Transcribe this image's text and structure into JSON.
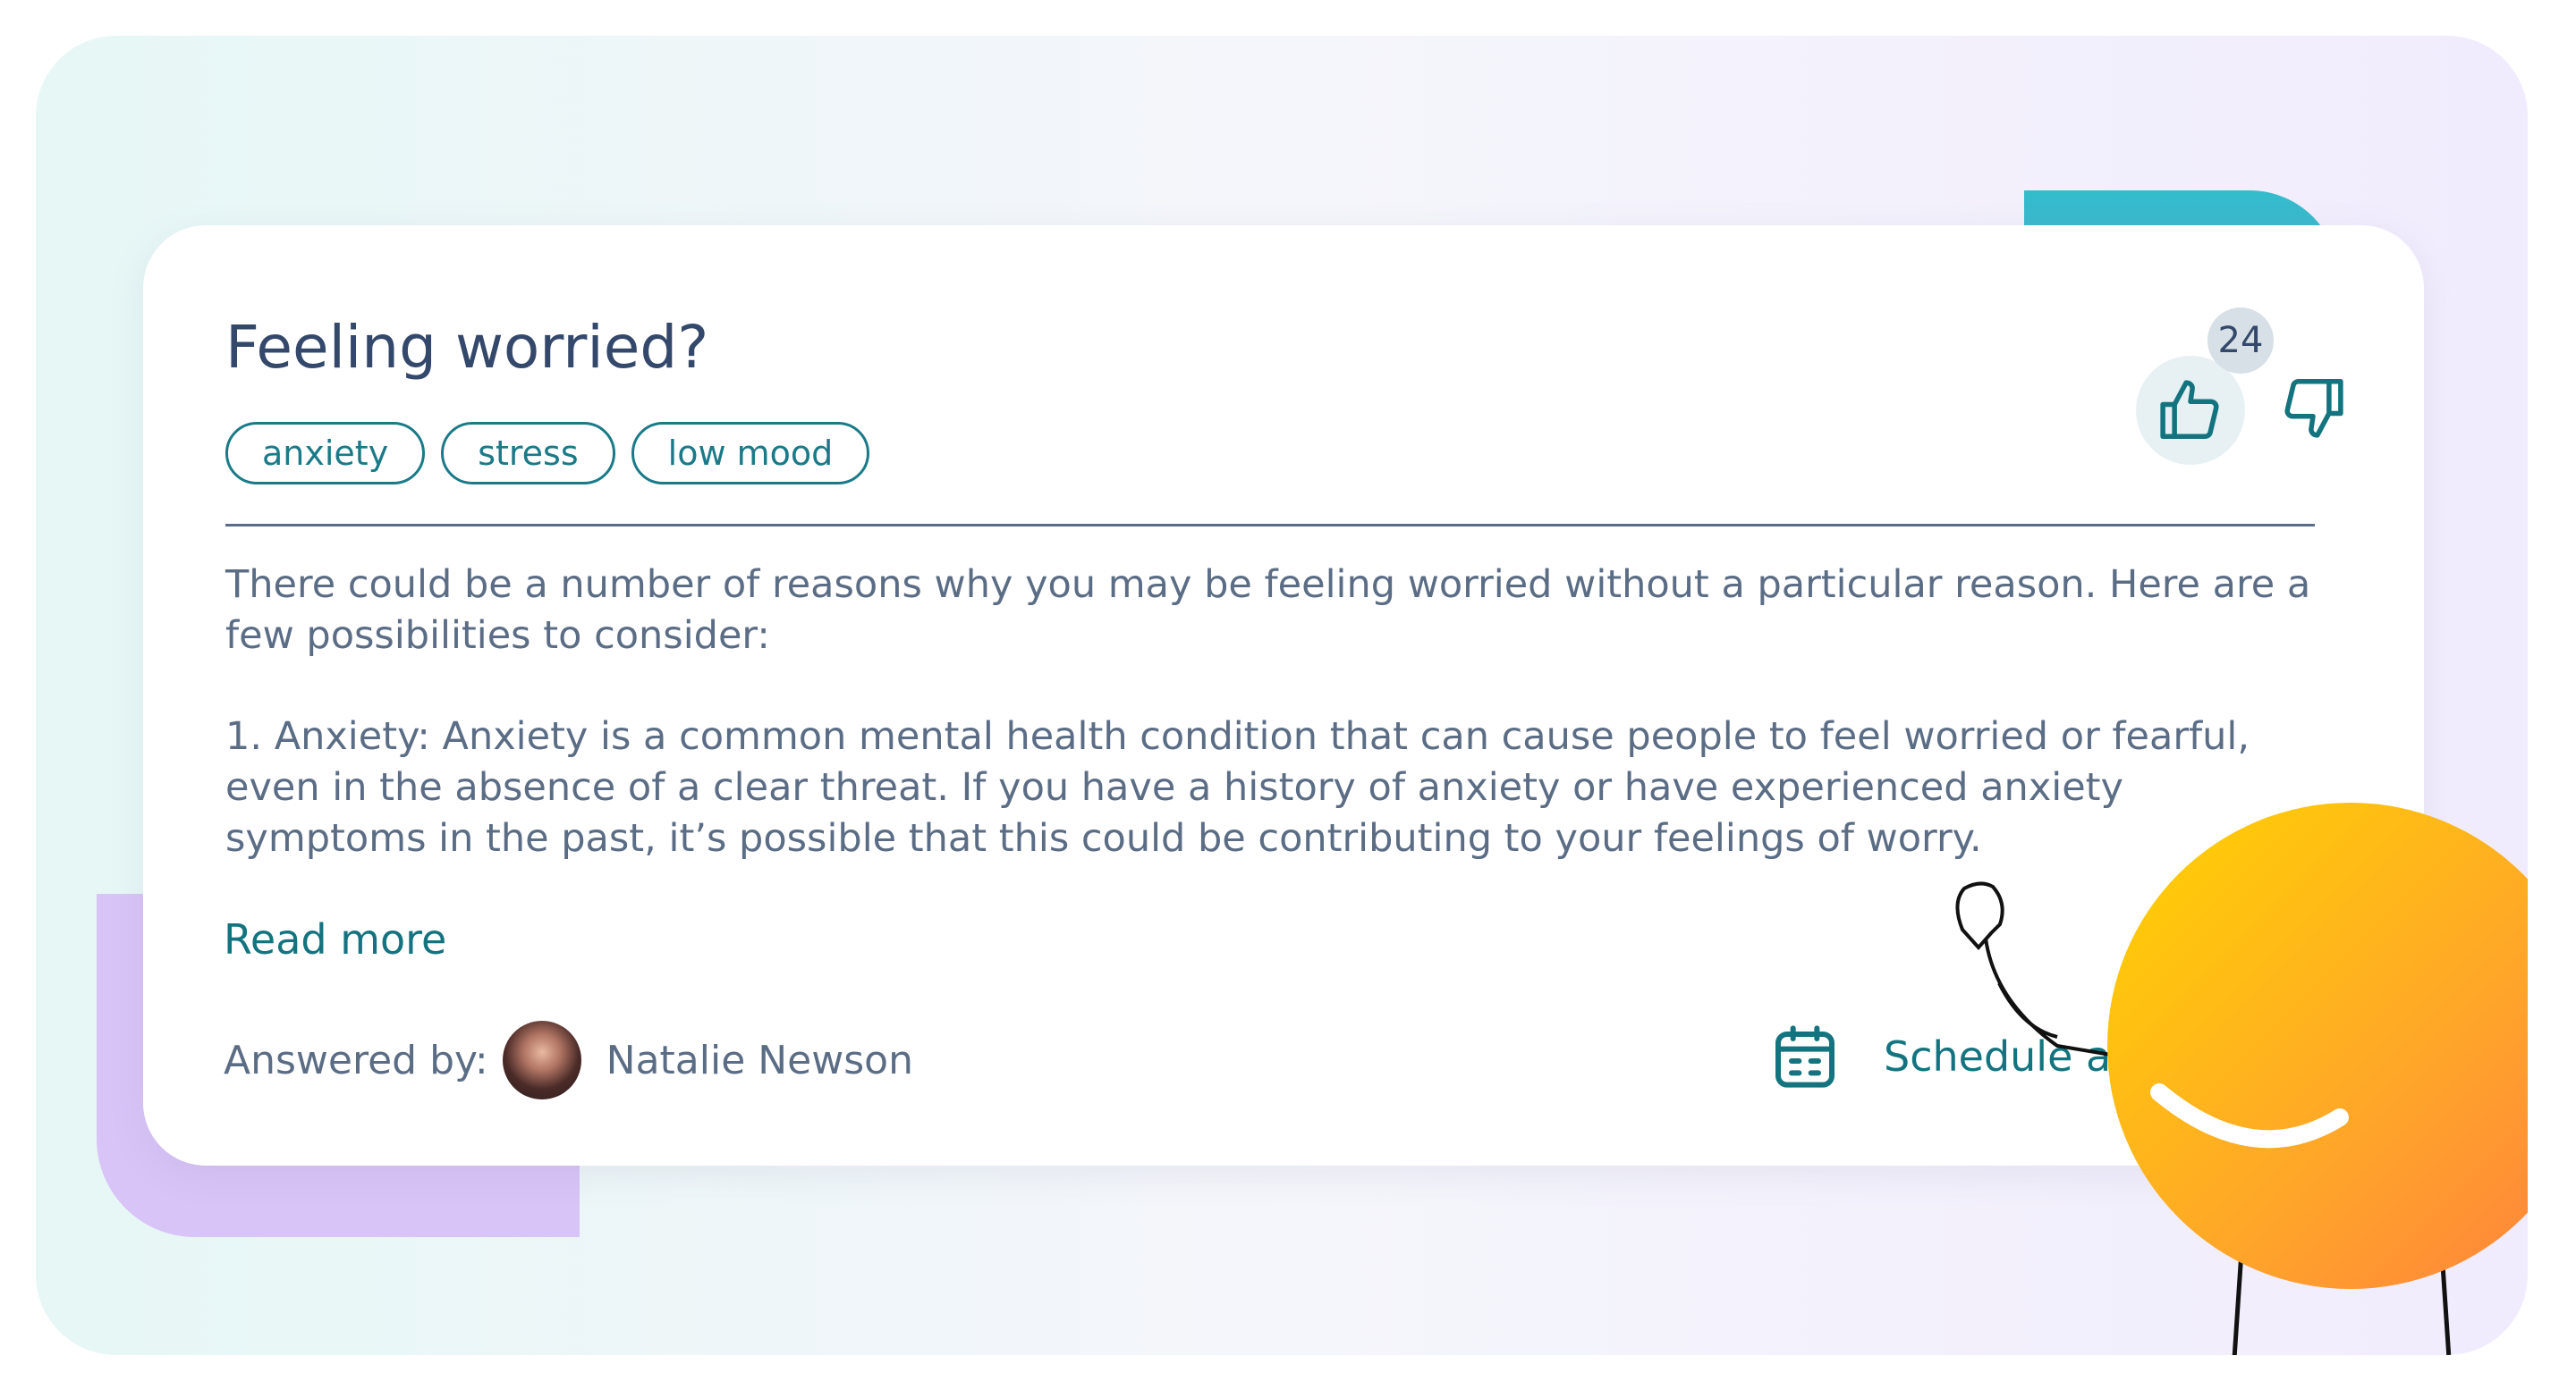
{
  "card": {
    "title": "Feeling worried?",
    "tags": [
      "anxiety",
      "stress",
      "low mood"
    ],
    "paragraphs": [
      "There could be a number of reasons why you may be feeling worried without a particular reason. Here are a few possibilities to consider:",
      "1. Anxiety: Anxiety is a common mental health condition that can cause people to feel worried or fearful, even in the absence of a clear threat. If you have a history of anxiety or have experienced anxiety symptoms in the past, it’s possible that this could be contributing to your feelings of worry."
    ],
    "read_more_label": "Read more",
    "answered_by_label": "Answered by:",
    "author_name": "Natalie Newson",
    "schedule_label": "Schedule a",
    "like_count": "24"
  },
  "icons": {
    "like": "thumbs-up-icon",
    "dislike": "thumbs-down-icon",
    "schedule": "calendar-icon"
  },
  "colors": {
    "accent": "#13747f",
    "text": "#5b6d85",
    "title": "#33486a",
    "teal_deco": "#3ab7c9",
    "lilac_deco": "#d9c4f7",
    "mascot_top": "#ffd400",
    "mascot_bottom": "#ff8a3d"
  }
}
